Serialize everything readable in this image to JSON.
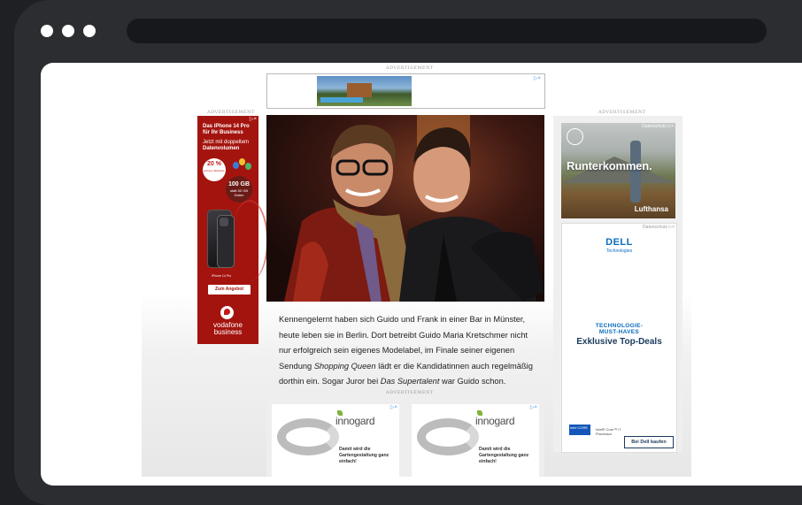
{
  "ad_label": "ADVERTISEMENT",
  "ad_choices_icon": "ad-choices-icon",
  "left_ad": {
    "brand": "Vodafone",
    "headline": "Das iPhone 14 Pro für Ihr Business",
    "line1": "Jetzt mit doppeltem",
    "line2": "Datenvolumen",
    "badge_percent": "20 %",
    "badge_sub": "auf den Tarifpreis",
    "gb_value": "100 GB",
    "gb_sub": "statt 50 GB Daten",
    "phone_caption": "iPhone 14 Pro",
    "cta": "Zum Angebot",
    "logo_line1": "vodafone",
    "logo_line2": "business"
  },
  "right_ad_1": {
    "headline": "Runterkommen.",
    "brand": "Lufthansa",
    "privacy": "Datenschutz"
  },
  "right_ad_2": {
    "logo": "DELL",
    "logo_sub": "Technologies",
    "kicker_line1": "TECHNOLOGIE-",
    "kicker_line2": "MUST-HAVES",
    "headline": "Exklusive Top-Deals",
    "intel_badge": "intel CORE",
    "intel_text": "Intel® Core™ i7 Processor",
    "cta": "Bei Dell kaufen",
    "privacy": "Datenschutz"
  },
  "article": {
    "text_1": "Kennengelernt haben sich Guido und Frank in einer Bar in Münster, heute leben sie in Berlin. Dort betreibt Guido Maria Kretschmer nicht nur erfolgreich sein eigenes Modelabel, im Finale seiner eigenen Sendung ",
    "show_1": "Shopping Queen",
    "text_2": " lädt er die Kandidatinnen auch regelmäßig dorthin ein. Sogar Juror bei ",
    "show_2": "Das Supertalent",
    "text_3": " war Guido schon."
  },
  "bottom_ads": [
    {
      "brand": "innogard",
      "tagline": "Damit wird die Gartengestaltung ganz einfach!"
    },
    {
      "brand": "innogard",
      "tagline": "Damit wird die Gartengestaltung ganz einfach!"
    }
  ]
}
